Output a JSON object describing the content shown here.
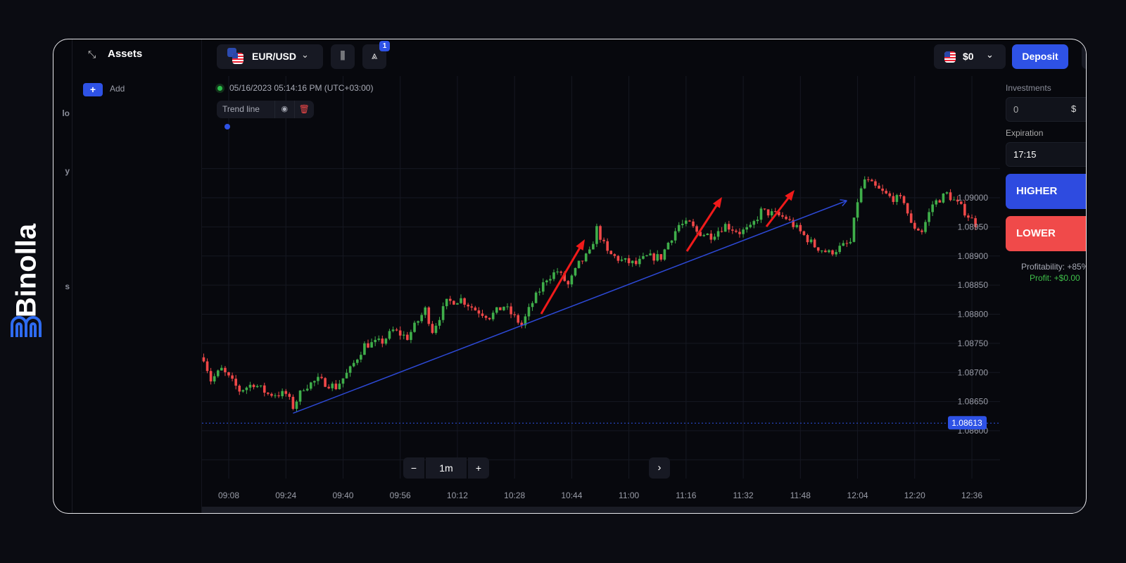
{
  "brand": {
    "name": "Binolla",
    "accent": "#2e6bf0"
  },
  "nav_fragments": [
    "lo",
    "y",
    "s"
  ],
  "assets": {
    "title": "Assets",
    "add_label": "Add",
    "add_icon": "+"
  },
  "header": {
    "pair": "EUR/USD",
    "balance": "$0",
    "deposit_label": "Deposit",
    "drawings_badge": "1"
  },
  "chart_info": {
    "datetime": "05/16/2023  05:14:16 PM  (UTC+03:00)",
    "tool_label": "Trend line"
  },
  "trade_panel": {
    "investments_label": "Investments",
    "investment_value": "0",
    "currency": "$",
    "expiration_label": "Expiration",
    "expiration_value": "17:15",
    "higher_label": "HIGHER",
    "lower_label": "LOWER",
    "profitability": "Profitability: +85%",
    "profit": "Profit: +$0.00"
  },
  "timeframe": {
    "value": "1m",
    "minus": "−",
    "plus": "+"
  },
  "chart_data": {
    "type": "candlestick",
    "y_ticks": [
      "1.09000",
      "1.08950",
      "1.08900",
      "1.08850",
      "1.08800",
      "1.08750",
      "1.08700",
      "1.08650",
      "1.08600"
    ],
    "x_ticks": [
      "09:08",
      "09:24",
      "09:40",
      "09:56",
      "10:12",
      "10:28",
      "10:44",
      "11:00",
      "11:16",
      "11:32",
      "11:48",
      "12:04",
      "12:20",
      "12:36"
    ],
    "current_price": "1.08613",
    "colors": {
      "up": "#3fae4a",
      "down": "#f04848",
      "trend": "#2d49d6",
      "arrow": "#f01a1a"
    },
    "trend_line": {
      "from": [
        "09:26",
        1.0863
      ],
      "to": [
        "12:01",
        1.08995
      ]
    },
    "close_path": [
      [
        "09:01",
        1.08726
      ],
      [
        "09:03",
        1.08687
      ],
      [
        "09:06",
        1.08705
      ],
      [
        "09:11",
        1.08669
      ],
      [
        "09:15",
        1.08681
      ],
      [
        "09:19",
        1.08663
      ],
      [
        "09:24",
        1.08663
      ],
      [
        "09:26",
        1.08641
      ],
      [
        "09:29",
        1.08675
      ],
      [
        "09:33",
        1.08687
      ],
      [
        "09:38",
        1.08675
      ],
      [
        "09:42",
        1.08705
      ],
      [
        "09:46",
        1.08747
      ],
      [
        "09:51",
        1.08753
      ],
      [
        "09:54",
        1.08772
      ],
      [
        "09:58",
        1.0876
      ],
      [
        "10:03",
        1.08808
      ],
      [
        "10:05",
        1.08772
      ],
      [
        "10:09",
        1.0882
      ],
      [
        "10:13",
        1.08826
      ],
      [
        "10:17",
        1.08808
      ],
      [
        "10:21",
        1.08796
      ],
      [
        "10:25",
        1.08814
      ],
      [
        "10:30",
        1.08781
      ],
      [
        "10:33",
        1.0882
      ],
      [
        "10:37",
        1.08862
      ],
      [
        "10:40",
        1.08874
      ],
      [
        "10:43",
        1.0885
      ],
      [
        "10:46",
        1.08886
      ],
      [
        "10:49",
        1.08905
      ],
      [
        "10:51",
        1.08947
      ],
      [
        "10:54",
        1.08905
      ],
      [
        "10:58",
        1.08892
      ],
      [
        "11:02",
        1.08886
      ],
      [
        "11:05",
        1.08898
      ],
      [
        "11:09",
        1.08898
      ],
      [
        "11:11",
        1.08923
      ],
      [
        "11:14",
        1.08953
      ],
      [
        "11:17",
        1.08955
      ],
      [
        "11:19",
        1.08941
      ],
      [
        "11:23",
        1.08935
      ],
      [
        "11:27",
        1.08953
      ],
      [
        "11:31",
        1.08941
      ],
      [
        "11:34",
        1.08947
      ],
      [
        "11:37",
        1.08977
      ],
      [
        "11:41",
        1.08971
      ],
      [
        "11:44",
        1.08965
      ],
      [
        "11:48",
        1.08941
      ],
      [
        "11:52",
        1.08917
      ],
      [
        "11:56",
        1.08905
      ],
      [
        "12:00",
        1.08917
      ],
      [
        "12:02",
        1.08923
      ],
      [
        "12:04",
        1.08995
      ],
      [
        "12:06",
        1.09031
      ],
      [
        "12:10",
        1.09013
      ],
      [
        "12:13",
        1.09001
      ],
      [
        "12:17",
        1.08995
      ],
      [
        "12:19",
        1.08953
      ],
      [
        "12:22",
        1.08943
      ],
      [
        "12:25",
        1.08989
      ],
      [
        "12:29",
        1.09007
      ],
      [
        "12:33",
        1.08983
      ],
      [
        "12:37",
        1.08955
      ]
    ]
  }
}
